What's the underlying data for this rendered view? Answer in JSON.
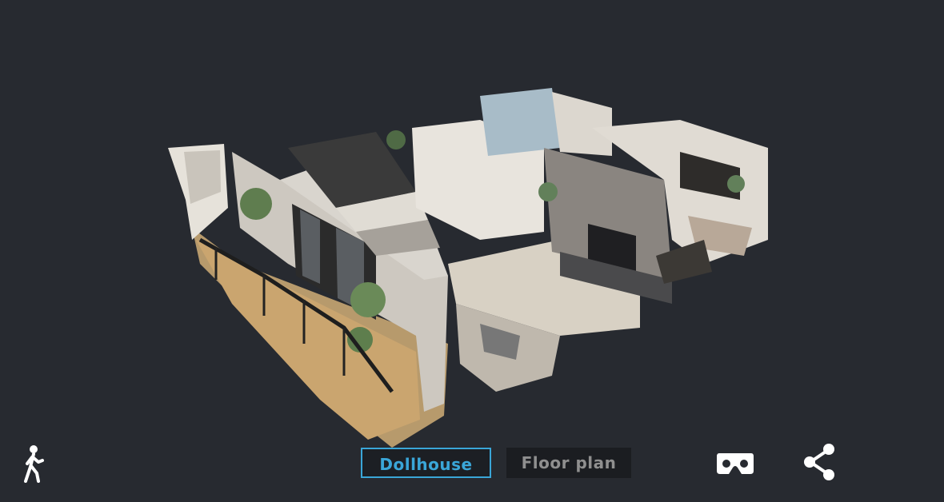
{
  "viewer": {
    "background_color": "#272a30",
    "accent_color": "#3aa6d8"
  },
  "toolbar": {
    "walk_icon": "person-walking-icon",
    "tabs": [
      {
        "label": "Dollhouse",
        "active": true
      },
      {
        "label": "Floor plan",
        "active": false
      }
    ],
    "vr_icon": "vr-headset-icon",
    "share_icon": "share-icon"
  }
}
